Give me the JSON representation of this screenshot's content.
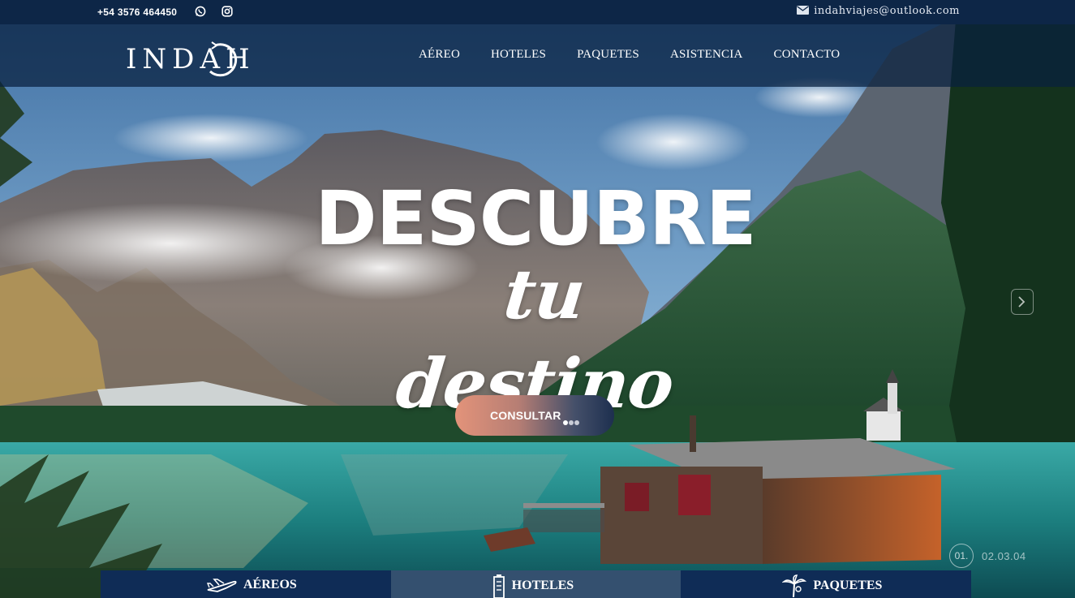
{
  "topbar": {
    "phone": "+54 3576 464450",
    "email": "indahviajes@outlook.com",
    "social_icons": [
      "whatsapp-icon",
      "instagram-icon"
    ],
    "email_icon": "envelope-icon"
  },
  "brand": {
    "logo_text": "INDAH"
  },
  "nav": {
    "links": [
      {
        "label": "AÉREO"
      },
      {
        "label": "HOTELES"
      },
      {
        "label": "PAQUETES"
      },
      {
        "label": "ASISTENCIA"
      },
      {
        "label": "CONTACTO"
      }
    ]
  },
  "hero": {
    "headline": "DESCUBRE",
    "subline": "tu destino",
    "cta_label": "CONSULTAR",
    "slide_current": "01.",
    "slide_rest": "02.03.04"
  },
  "tabs": [
    {
      "label": "AÉREOS",
      "icon": "airplane-icon"
    },
    {
      "label": "HOTELES",
      "icon": "hotel-building-icon"
    },
    {
      "label": "PAQUETES",
      "icon": "palm-tree-icon"
    }
  ],
  "colors": {
    "topbar_bg": "#0d2647",
    "navbar_bg": "#08203e",
    "cta_gradient_start": "#e3937a",
    "cta_gradient_end": "#1d2f4f",
    "tab_dark": "#0f2c56",
    "tab_active": "#34506f"
  }
}
